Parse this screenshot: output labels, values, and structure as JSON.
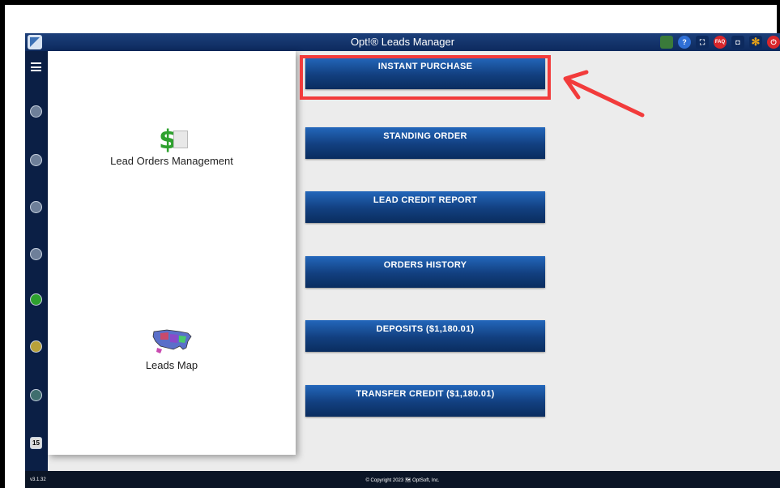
{
  "window": {
    "title": "Opt!® Leads Manager"
  },
  "toolbar_icons": [
    {
      "name": "app-switch-icon",
      "label": "",
      "color": "#3a7a3a"
    },
    {
      "name": "help-icon",
      "label": "?",
      "color": "#2f6fd6"
    },
    {
      "name": "fullscreen-icon",
      "label": "⛶",
      "color": "#0d2a5e"
    },
    {
      "name": "faq-icon",
      "label": "FAQ",
      "color": "#d9262b"
    },
    {
      "name": "camera-icon",
      "label": "◘",
      "color": "#0d2a5e"
    },
    {
      "name": "settings-icon",
      "label": "✻",
      "color": "#e8a317"
    },
    {
      "name": "power-icon",
      "label": "⏻",
      "color": "#d9262b"
    }
  ],
  "sidebar": {
    "items": [
      {
        "name": "home-icon"
      },
      {
        "name": "contacts-icon"
      },
      {
        "name": "tasks-icon"
      },
      {
        "name": "email-icon"
      },
      {
        "name": "leads-icon"
      },
      {
        "name": "reports-icon"
      },
      {
        "name": "globe-icon"
      },
      {
        "name": "calendar-icon",
        "label": "15"
      }
    ]
  },
  "left_panel": {
    "lead_orders_label": "Lead Orders Management",
    "leads_map_label": "Leads Map"
  },
  "buttons": [
    "INSTANT PURCHASE",
    "STANDING ORDER",
    "LEAD CREDIT REPORT",
    "ORDERS HISTORY",
    "DEPOSITS   ($1,180.01)",
    "TRANSFER CREDIT   ($1,180.01)"
  ],
  "footer": {
    "version": "v3.1.32",
    "copyright": "© Copyright 2023 🗺 OptSoft, Inc."
  },
  "annotation": {
    "color": "#f23b3b"
  }
}
